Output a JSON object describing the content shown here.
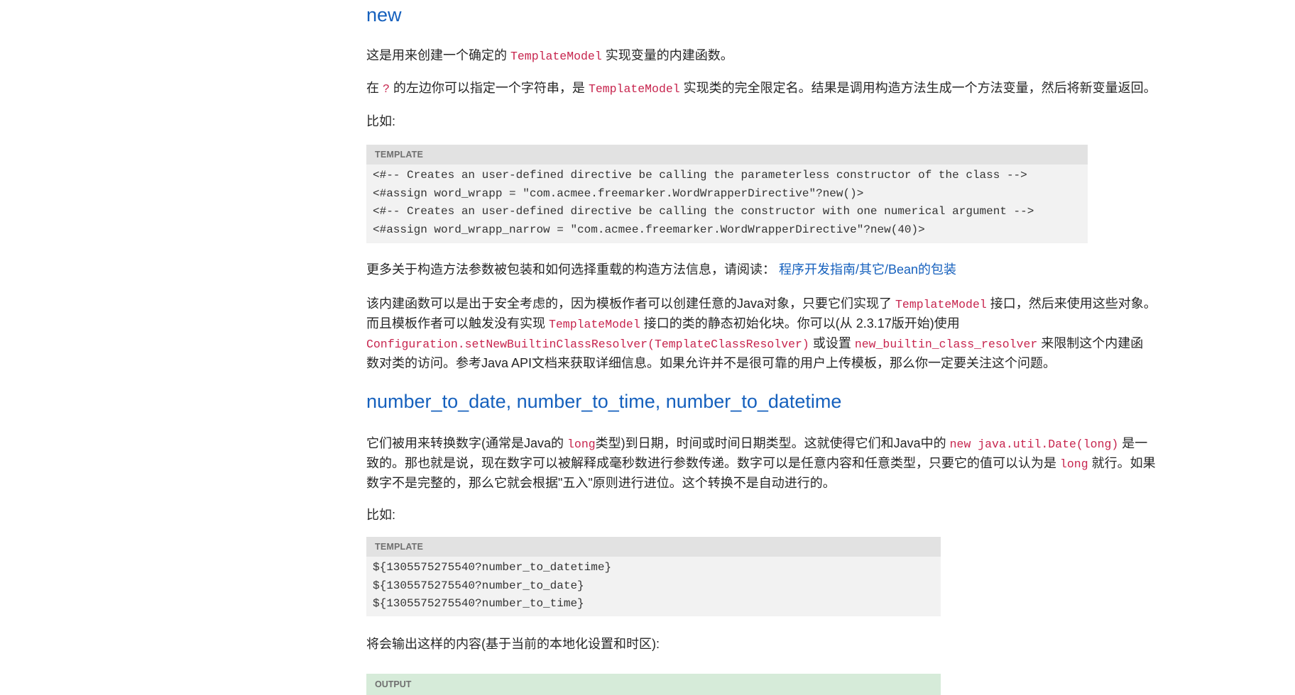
{
  "section_new": {
    "title": "new",
    "p1": {
      "a": "这是用来创建一个确定的 ",
      "code": "TemplateModel",
      "b": " 实现变量的内建函数。"
    },
    "p2": {
      "a": "在 ",
      "code1": "?",
      "b": " 的左边你可以指定一个字符串，是 ",
      "code2": "TemplateModel",
      "c": " 实现类的完全限定名。结果是调用构造方法生成一个方法变量，然后将新变量返回。"
    },
    "example_label": "比如:",
    "template_box": {
      "header": "TEMPLATE",
      "lines": [
        "<#-- Creates an user-defined directive be calling the parameterless constructor of the class -->",
        "<#assign word_wrapp = \"com.acmee.freemarker.WordWrapperDirective\"?new()>",
        "<#-- Creates an user-defined directive be calling the constructor with one numerical argument -->",
        "<#assign word_wrapp_narrow = \"com.acmee.freemarker.WordWrapperDirective\"?new(40)>"
      ]
    },
    "more_info": {
      "text": "更多关于构造方法参数被包装和如何选择重载的构造方法信息，请阅读： ",
      "link": "程序开发指南/其它/Bean的包装"
    },
    "security": {
      "l1a": "该内建函数可以是出于安全考虑的，因为模板作者可以创建任意的Java对象，只要它们实现了 ",
      "l1code": "TemplateModel",
      "l1b": " 接口，然后来使用这些对象。",
      "l2a": "而且模板作者可以触发没有实现 ",
      "l2code": "TemplateModel",
      "l2b": " 接口的类的静态初始化块。你可以(从 2.3.17版开始)使用",
      "l3code1": "Configuration.setNewBuiltinClassResolver(TemplateClassResolver)",
      "l3a": " 或设置 ",
      "l3code2": "new_builtin_class_resolver",
      "l3b": " 来限制这个内建函",
      "l4": "数对类的访问。参考Java API文档来获取详细信息。如果允许并不是很可靠的用户上传模板，那么你一定要关注这个问题。"
    }
  },
  "section_number": {
    "title": "number_to_date, number_to_time, number_to_datetime",
    "desc": {
      "l1a": "它们被用来转换数字(通常是Java的 ",
      "l1code1": "long",
      "l1b": "类型)到日期，时间或时间日期类型。这就使得它们和Java中的 ",
      "l1code2": "new java.util.Date(long)",
      "l1c": " 是一",
      "l2a": "致的。那也就是说，现在数字可以被解释成毫秒数进行参数传递。数字可以是任意内容和任意类型，只要它的值可以认为是 ",
      "l2code": "long",
      "l2b": " 就行。如果",
      "l3": "数字不是完整的，那么它就会根据\"五入\"原则进行进位。这个转换不是自动进行的。"
    },
    "example_label": "比如:",
    "template_box": {
      "header": "TEMPLATE",
      "lines": [
        "${1305575275540?number_to_datetime}",
        "${1305575275540?number_to_date}",
        "${1305575275540?number_to_time}"
      ]
    },
    "output_label": "将会输出这样的内容(基于当前的本地化设置和时区):",
    "output_box": {
      "header": "OUTPUT"
    }
  }
}
